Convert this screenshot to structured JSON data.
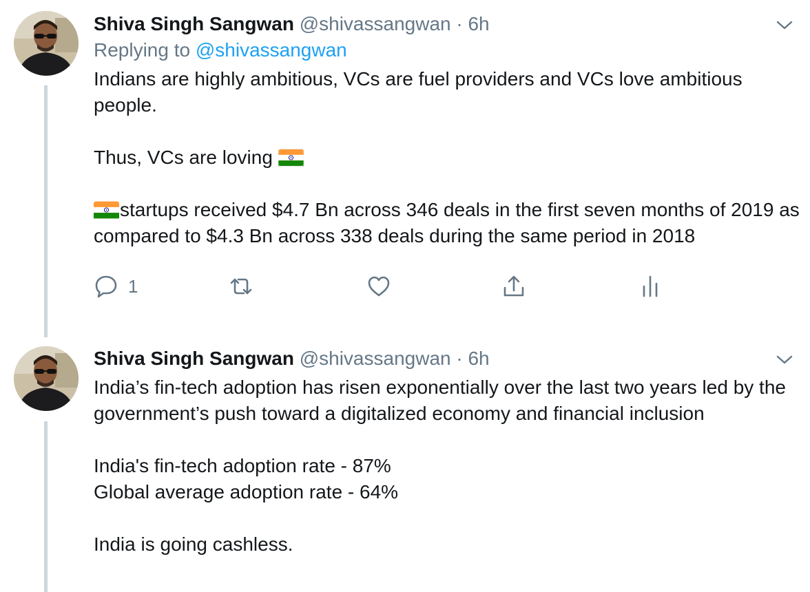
{
  "tweets": [
    {
      "name": "Shiva Singh Sangwan",
      "handle": "@shivassangwan",
      "separator": "·",
      "time": "6h",
      "replying_label": "Replying to",
      "replying_handle": "@shivassangwan",
      "para1": "Indians are highly ambitious, VCs are fuel providers and VCs love ambitious people.",
      "para2": "Thus, VCs are loving",
      "para3": "startups received $4.7 Bn across 346 deals in the first seven months of 2019 as compared to $4.3 Bn across 338 deals during the same period in 2018",
      "reply_count": "1",
      "icons": [
        "reply-icon",
        "retweet-icon",
        "like-icon",
        "share-icon",
        "analytics-icon"
      ]
    },
    {
      "name": "Shiva Singh Sangwan",
      "handle": "@shivassangwan",
      "separator": "·",
      "time": "6h",
      "para1": "India’s fin-tech adoption has risen exponentially over the last two years led by the government’s push toward a digitalized economy and financial inclusion",
      "line1": "India's fin-tech adoption rate - 87%",
      "line2": "Global average adoption rate - 64%",
      "para3": "India is going cashless."
    }
  ],
  "colors": {
    "text": "#14171a",
    "secondary": "#657786",
    "link": "#1da1f2",
    "thread_line": "#ccd6dd",
    "flag_saffron": "#ff9933",
    "flag_green": "#138808",
    "flag_chakra": "#000080"
  }
}
